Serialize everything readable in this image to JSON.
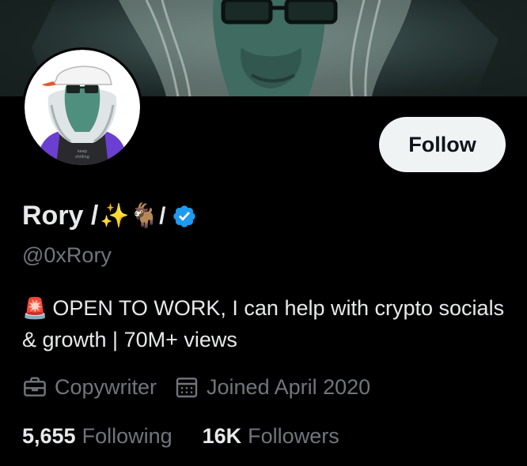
{
  "profile": {
    "display_name": "Rory /",
    "name_emojis": "✨🐐/",
    "handle": "@0xRory",
    "bio_siren": "🚨",
    "bio": "OPEN TO WORK, I can help with crypto socials & growth | 70M+ views",
    "profession": "Copywriter",
    "joined": "Joined April 2020",
    "verified": true,
    "avatar_shirt_text": "Keep shilling"
  },
  "actions": {
    "follow_label": "Follow"
  },
  "stats": {
    "following_count": "5,655",
    "following_label": "Following",
    "followers_count": "16K",
    "followers_label": "Followers"
  },
  "icons": {
    "verified": "verified-badge-icon",
    "profession": "briefcase-icon",
    "joined": "calendar-icon"
  },
  "colors": {
    "background": "#000000",
    "follow_button_bg": "#eff3f4",
    "verified_blue": "#1d9bf0",
    "secondary_text": "#71767b"
  }
}
